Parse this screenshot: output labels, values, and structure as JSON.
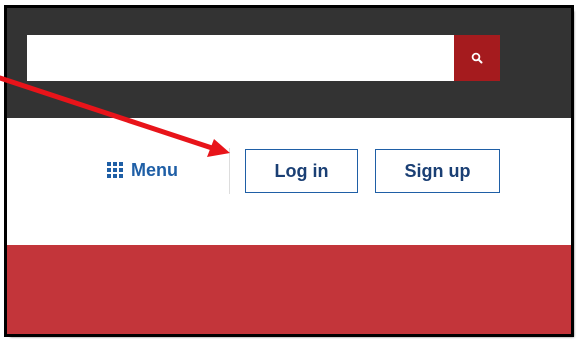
{
  "search": {
    "placeholder": "",
    "value": "",
    "button_icon": "search-icon"
  },
  "nav": {
    "menu_label": "Menu",
    "menu_icon": "grid-icon",
    "login_label": "Log in",
    "signup_label": "Sign up"
  },
  "colors": {
    "top_bar": "#333333",
    "search_button": "#a51b1e",
    "link_blue": "#1f5fa6",
    "banner_red": "#c3353a",
    "annotation_arrow": "#e8141a"
  }
}
